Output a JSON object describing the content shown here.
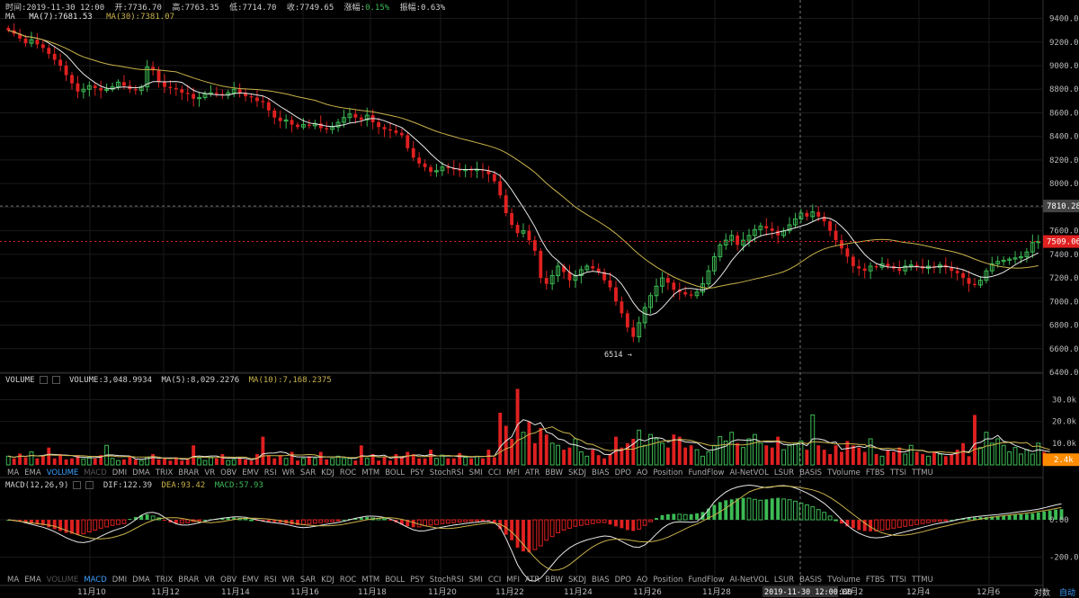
{
  "info_bar": {
    "time": "时间:2019-11-30 12:00",
    "open": "开:7736.70",
    "high": "高:7763.35",
    "low": "低:7714.70",
    "close": "收:7749.65",
    "change_label": "涨幅:",
    "change_value": "0.15%",
    "amplitude": "振幅:0.63%"
  },
  "ma_legend": {
    "prefix": "MA",
    "ma7": "MA(7):7681.53",
    "ma30": "MA(30):7381.07"
  },
  "volume_legend": {
    "title": "VOLUME",
    "volume": "VOLUME:3,048.9934",
    "ma5": "MA(5):8,029.2276",
    "ma10": "MA(10):7,168.2375"
  },
  "macd_legend": {
    "title": "MACD(12,26,9)",
    "dif": "DIF:122.39",
    "dea": "DEA:93.42",
    "macd": "MACD:57.93"
  },
  "indicator_tabs": [
    "MA",
    "EMA",
    "VOLUME",
    "MACD",
    "DMI",
    "DMA",
    "TRIX",
    "BRAR",
    "VR",
    "OBV",
    "EMV",
    "RSI",
    "WR",
    "SAR",
    "KDJ",
    "ROC",
    "MTM",
    "BOLL",
    "PSY",
    "StochRSI",
    "SMI",
    "CCI",
    "MFI",
    "ATR",
    "BBW",
    "SKDJ",
    "BIAS",
    "DPO",
    "AO",
    "Position",
    "FundFlow",
    "AI-NetVOL",
    "LSUR",
    "BASIS",
    "TVolume",
    "FTBS",
    "TTSI",
    "TTMU"
  ],
  "price_axis_labels": [
    "9400.00",
    "9200.00",
    "9000.00",
    "8800.00",
    "8600.00",
    "8400.00",
    "8200.00",
    "8000.00",
    "7800.00",
    "7600.00",
    "7400.00",
    "7200.00",
    "7000.00",
    "6800.00",
    "6600.00",
    "6400.00"
  ],
  "price_tag_high": "7810.28",
  "price_tag_last": "7509.06",
  "min_label": "6514",
  "volume_axis_labels": [
    "30.0k",
    "20.0k",
    "10.0k"
  ],
  "volume_tag": "2.4k",
  "macd_axis_labels": [
    "0.00",
    "-200.00"
  ],
  "date_labels": [
    "11月10",
    "11月12",
    "11月14",
    "11月16",
    "11月18",
    "11月20",
    "11月22",
    "11月24",
    "11月26",
    "11月28",
    "12月2",
    "12月4",
    "12月6"
  ],
  "crosshair_date": "2019-11-30 12:00:00",
  "bottom_buttons": {
    "log": "对数",
    "auto": "自动"
  },
  "colors": {
    "up": "#3cba54",
    "down": "#e02020",
    "ma7": "#e8e8e8",
    "ma30": "#c9b24a",
    "last_price": "#e02020",
    "highlight": "#ff8c00"
  },
  "chart_data": {
    "type": "candlestick",
    "price_ylim": [
      6400,
      9450
    ],
    "volume_ylim": [
      0,
      36000
    ],
    "macd_ylim": [
      -280,
      150
    ],
    "tick_dates": [
      "11月10",
      "11月12",
      "11月14",
      "11月16",
      "11月18",
      "11月20",
      "11月22",
      "11月24",
      "11月26",
      "11月28",
      "12月2",
      "12月4",
      "12月6"
    ],
    "close_series": [
      9300,
      9270,
      9230,
      9190,
      9220,
      9180,
      9150,
      9100,
      9050,
      9000,
      8920,
      8850,
      8780,
      8800,
      8830,
      8810,
      8790,
      8800,
      8820,
      8860,
      8830,
      8800,
      8790,
      8820,
      8990,
      8960,
      8860,
      8820,
      8810,
      8800,
      8770,
      8760,
      8720,
      8730,
      8760,
      8770,
      8760,
      8750,
      8770,
      8800,
      8770,
      8740,
      8730,
      8700,
      8690,
      8620,
      8560,
      8530,
      8540,
      8500,
      8480,
      8500,
      8490,
      8510,
      8470,
      8460,
      8480,
      8520,
      8560,
      8590,
      8560,
      8540,
      8580,
      8520,
      8480,
      8460,
      8450,
      8430,
      8410,
      8300,
      8220,
      8170,
      8140,
      8100,
      8110,
      8140,
      8130,
      8120,
      8110,
      8120,
      8110,
      8120,
      8110,
      8080,
      8020,
      7900,
      7750,
      7650,
      7580,
      7600,
      7520,
      7430,
      7200,
      7150,
      7220,
      7300,
      7250,
      7180,
      7220,
      7270,
      7300,
      7280,
      7250,
      7180,
      7120,
      7000,
      6900,
      6780,
      6700,
      6820,
      6950,
      7050,
      7130,
      7200,
      7160,
      7100,
      7080,
      7060,
      7050,
      7080,
      7150,
      7260,
      7380,
      7480,
      7520,
      7560,
      7480,
      7520,
      7560,
      7610,
      7640,
      7620,
      7600,
      7560,
      7600,
      7650,
      7700,
      7750,
      7720,
      7760,
      7720,
      7680,
      7600,
      7520,
      7450,
      7380,
      7300,
      7280,
      7260,
      7300,
      7290,
      7320,
      7300,
      7280,
      7260,
      7300,
      7310,
      7300,
      7280,
      7300,
      7290,
      7310,
      7290,
      7260,
      7240,
      7200,
      7150,
      7140,
      7180,
      7260,
      7320,
      7340,
      7350,
      7360,
      7370,
      7380,
      7420,
      7500,
      7509
    ],
    "volume_series": [
      4000,
      3000,
      5200,
      3500,
      6000,
      3000,
      4000,
      8000,
      3000,
      5000,
      2500,
      3000,
      4500,
      2800,
      3500,
      3000,
      4500,
      9000,
      3000,
      2000,
      2500,
      4000,
      2500,
      2000,
      3500,
      5000,
      2500,
      3000,
      2000,
      3500,
      2000,
      3000,
      9000,
      3000,
      2000,
      3500,
      3000,
      5000,
      2000,
      2500,
      3000,
      2500,
      2000,
      5000,
      13000,
      4500,
      3000,
      4500,
      3000,
      6000,
      2000,
      3000,
      4000,
      3000,
      6000,
      2500,
      3000,
      4000,
      3000,
      3000,
      2000,
      9000,
      3000,
      5000,
      2000,
      3500,
      2000,
      5000,
      4000,
      6000,
      5000,
      3000,
      3000,
      7000,
      3000,
      4500,
      3000,
      3000,
      5500,
      3500,
      3000,
      4000,
      3000,
      7000,
      3500,
      24000,
      18000,
      12000,
      35000,
      15000,
      20000,
      10000,
      17000,
      14000,
      10000,
      9000,
      7000,
      8000,
      12000,
      6000,
      4000,
      7000,
      4500,
      3000,
      5000,
      13000,
      8000,
      10000,
      12000,
      16000,
      9000,
      14000,
      12000,
      10000,
      8000,
      14000,
      13000,
      8000,
      9000,
      7000,
      4000,
      6000,
      9000,
      13000,
      11000,
      15000,
      10000,
      8000,
      12000,
      14000,
      10000,
      9000,
      8000,
      13000,
      7000,
      9000,
      10000,
      11000,
      7000,
      23000,
      9000,
      7000,
      5000,
      9000,
      6000,
      11000,
      9000,
      8000,
      6000,
      12000,
      5000,
      4000,
      7000,
      6000,
      8000,
      5000,
      9000,
      6000,
      5000,
      4000,
      6000,
      5000,
      4000,
      5000,
      7000,
      10000,
      4000,
      23000,
      8000,
      15000,
      10000,
      12000,
      9000,
      6000,
      8000,
      5000,
      7000,
      5000,
      10000,
      6000,
      2400
    ],
    "macd_hist": [
      0,
      -5,
      -10,
      -15,
      -20,
      -25,
      -30,
      -40,
      -50,
      -60,
      -70,
      -75,
      -80,
      -75,
      -65,
      -55,
      -45,
      -38,
      -30,
      -25,
      -20,
      5,
      15,
      25,
      30,
      20,
      10,
      -5,
      -15,
      -20,
      -18,
      -15,
      -10,
      -5,
      0,
      3,
      5,
      8,
      10,
      12,
      8,
      5,
      0,
      -5,
      -8,
      -10,
      -12,
      -15,
      -20,
      -25,
      -28,
      -25,
      -22,
      -18,
      -15,
      -12,
      -10,
      -5,
      0,
      5,
      10,
      12,
      15,
      10,
      8,
      5,
      -5,
      -15,
      -25,
      -35,
      -40,
      -38,
      -32,
      -28,
      -25,
      -20,
      -18,
      -15,
      -12,
      -10,
      -8,
      -6,
      -4,
      -6,
      -20,
      -50,
      -80,
      -110,
      -150,
      -170,
      -175,
      -160,
      -140,
      -110,
      -90,
      -70,
      -55,
      -45,
      -35,
      -30,
      -25,
      -20,
      -15,
      -15,
      -25,
      -35,
      -45,
      -55,
      -60,
      -50,
      -30,
      -10,
      10,
      25,
      30,
      32,
      30,
      28,
      30,
      35,
      42,
      60,
      80,
      95,
      105,
      110,
      115,
      118,
      116,
      110,
      105,
      110,
      115,
      118,
      112,
      108,
      100,
      90,
      80,
      70,
      55,
      40,
      20,
      0,
      -20,
      -35,
      -45,
      -55,
      -60,
      -62,
      -60,
      -55,
      -50,
      -45,
      -40,
      -35,
      -30,
      -25,
      -20,
      -15,
      -10,
      -8,
      -5,
      0,
      5,
      8,
      10,
      12,
      15,
      15,
      18,
      20,
      22,
      25,
      28,
      30,
      32,
      35,
      40,
      45,
      50,
      55,
      57
    ]
  }
}
